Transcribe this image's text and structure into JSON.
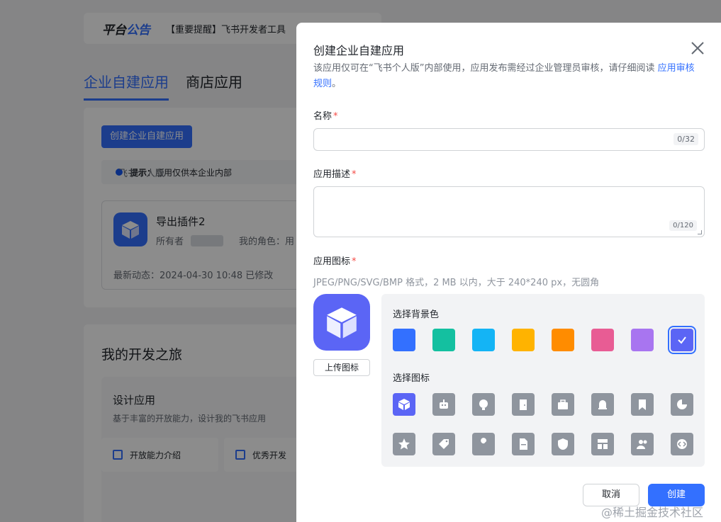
{
  "notice": {
    "brand_a": "平台",
    "brand_b": "公告",
    "text": "【重要提醒】飞书开发者工具"
  },
  "tabs": [
    {
      "label": "企业自建应用"
    },
    {
      "label": "商店应用"
    }
  ],
  "create_button": "创建企业自建应用",
  "tip": {
    "label": "飞书个人版",
    "bold": "提示：",
    "text": "应用仅供本企业内部"
  },
  "app": {
    "name": "导出插件2",
    "owner_label": "所有者",
    "role_label": "我的角色：用",
    "dynamic": "最新动态：2024-04-30 10:48 已修改"
  },
  "journey": {
    "title": "我的开发之旅",
    "design_title": "设计应用",
    "design_desc": "基于丰富的开放能力，设计我的飞书应用",
    "chips": [
      "开放能力介绍",
      "优秀开发"
    ]
  },
  "modal": {
    "title": "创建企业自建应用",
    "desc": "该应用仅可在“飞书个人版”内部使用，应用发布需经过企业管理员审核，请仔细阅读",
    "desc_link": "应用审核规则",
    "desc_end": "。",
    "name_label": "名称",
    "name_count": "0/32",
    "desc_label": "应用描述",
    "desc_count": "0/120",
    "icon_label": "应用图标",
    "icon_hint": "JPEG/PNG/SVG/BMP 格式，2 MB 以内，大于 240*240 px，无圆角",
    "upload": "上传图标",
    "bg_label": "选择背景色",
    "icon_pick_label": "选择图标",
    "colors": [
      "#3370ff",
      "#14c0a0",
      "#14b4f5",
      "#ffb300",
      "#ff8c00",
      "#e85c94",
      "#a875f0",
      "#5b65f5"
    ],
    "selected_color_index": 7,
    "icons": [
      "cube-icon",
      "robot-icon",
      "bulb-icon",
      "door-icon",
      "briefcase-icon",
      "bell-icon",
      "bookmark-icon",
      "pie-icon",
      "star-icon",
      "tag-icon",
      "wrench-icon",
      "document-icon",
      "shield-icon",
      "layout-icon",
      "people-icon",
      "code-icon"
    ],
    "selected_icon_index": 0,
    "cancel": "取消",
    "ok": "创建"
  },
  "watermark": "@稀土掘金技术社区"
}
